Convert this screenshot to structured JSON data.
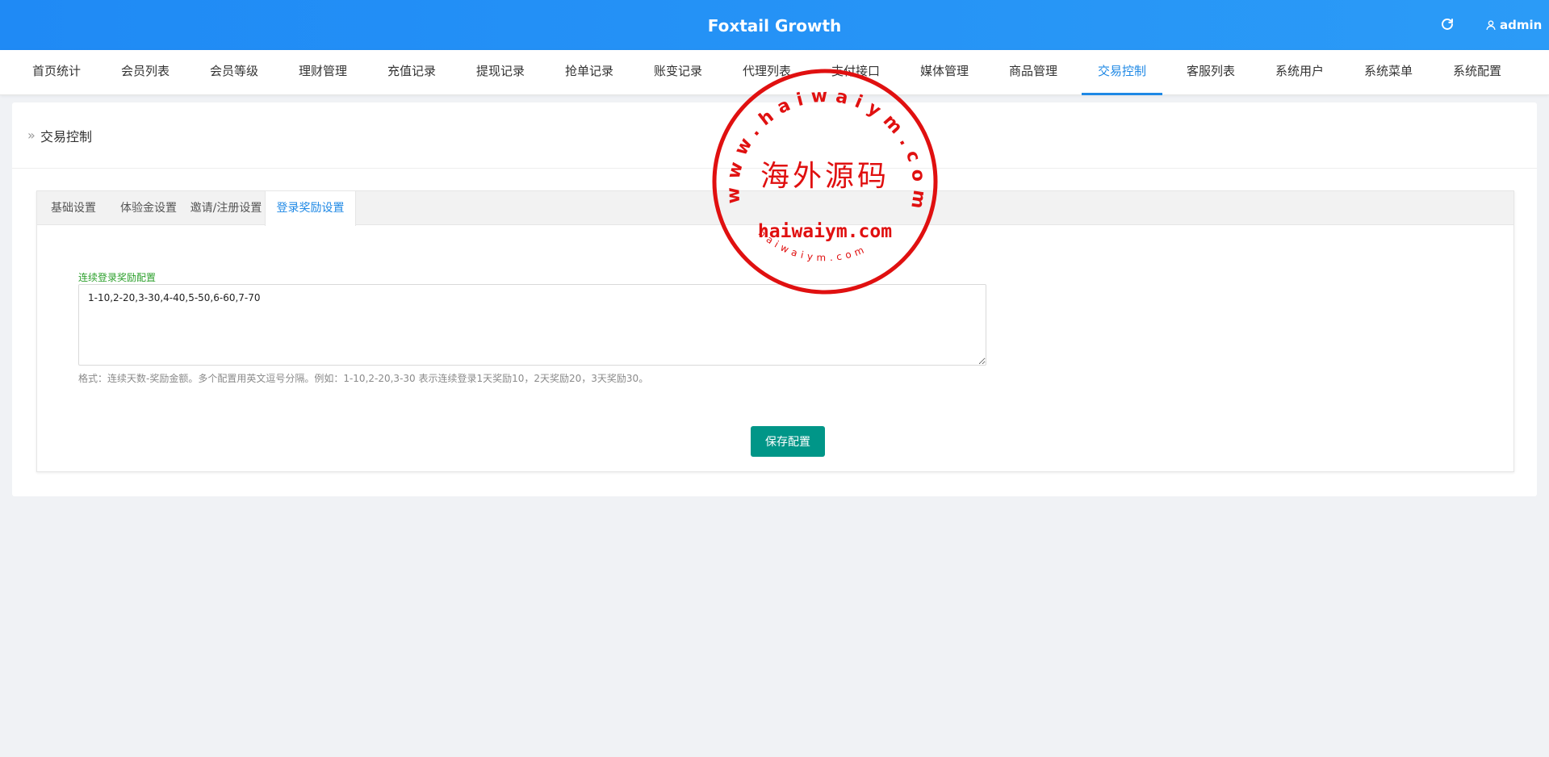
{
  "header": {
    "title": "Foxtail Growth",
    "user": "admin",
    "refresh_icon": "refresh-icon",
    "user_icon": "user-icon"
  },
  "nav": {
    "items": [
      "首页统计",
      "会员列表",
      "会员等级",
      "理财管理",
      "充值记录",
      "提现记录",
      "抢单记录",
      "账变记录",
      "代理列表",
      "支付接口",
      "媒体管理",
      "商品管理",
      "交易控制",
      "客服列表",
      "系统用户",
      "系统菜单",
      "系统配置"
    ],
    "active_index": 12
  },
  "page": {
    "breadcrumb_icon": "»",
    "title": "交易控制"
  },
  "tabs": {
    "items": [
      "基础设置",
      "体验金设置",
      "邀请/注册设置",
      "登录奖励设置"
    ],
    "active_index": 3
  },
  "form": {
    "label": "连续登录奖励配置",
    "value": "1-10,2-20,3-30,4-40,5-50,6-60,7-70",
    "hint": "格式：连续天数-奖励金额。多个配置用英文逗号分隔。例如：1-10,2-20,3-30 表示连续登录1天奖励10，2天奖励20，3天奖励30。",
    "save_label": "保存配置"
  },
  "watermark": {
    "outer_text": "www.haiwaiym.com",
    "center_text": "海外源码",
    "domain_text": "haiwaiym.com",
    "small_text": "haiwaiym.com",
    "color": "#e01010"
  },
  "colors": {
    "header": "#1f8af5",
    "accent": "#1e88e5",
    "button": "#009688",
    "label": "#2ca02c"
  }
}
